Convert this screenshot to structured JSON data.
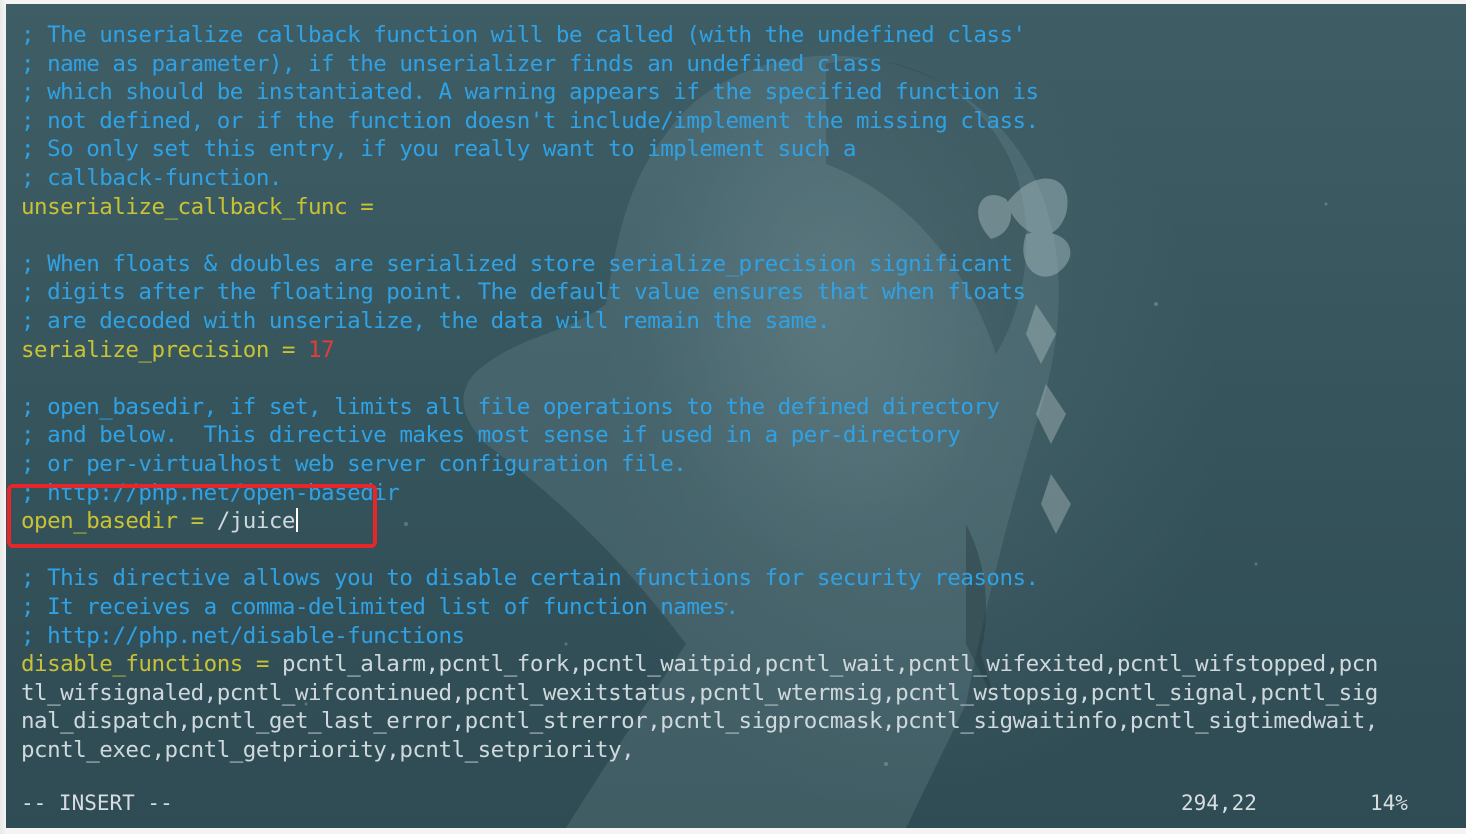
{
  "editor": {
    "lines": [
      {
        "segments": [
          {
            "t": "; The unserialize callback function will be called (with the undefined class'",
            "c": "c-cmt"
          }
        ]
      },
      {
        "segments": [
          {
            "t": "; name as parameter), if the unserializer finds an undefined class",
            "c": "c-cmt"
          }
        ]
      },
      {
        "segments": [
          {
            "t": "; which should be instantiated. A warning appears if the specified function is",
            "c": "c-cmt"
          }
        ]
      },
      {
        "segments": [
          {
            "t": "; not defined, or if the function doesn't include/implement the missing class.",
            "c": "c-cmt"
          }
        ]
      },
      {
        "segments": [
          {
            "t": "; So only set this entry, if you really want to implement such a",
            "c": "c-cmt"
          }
        ]
      },
      {
        "segments": [
          {
            "t": "; callback-function.",
            "c": "c-cmt"
          }
        ]
      },
      {
        "segments": [
          {
            "t": "unserialize_callback_func =",
            "c": "c-key"
          }
        ]
      },
      {
        "segments": []
      },
      {
        "segments": [
          {
            "t": "; When floats & doubles are serialized store serialize_precision significant",
            "c": "c-cmt"
          }
        ]
      },
      {
        "segments": [
          {
            "t": "; digits after the floating point. The default value ensures that when floats",
            "c": "c-cmt"
          }
        ]
      },
      {
        "segments": [
          {
            "t": "; are decoded with unserialize, the data will remain the same.",
            "c": "c-cmt"
          }
        ]
      },
      {
        "segments": [
          {
            "t": "serialize_precision = ",
            "c": "c-key"
          },
          {
            "t": "17",
            "c": "c-num"
          }
        ]
      },
      {
        "segments": []
      },
      {
        "segments": [
          {
            "t": "; open_basedir, if set, limits all file operations to the defined directory",
            "c": "c-cmt"
          }
        ]
      },
      {
        "segments": [
          {
            "t": "; and below.  This directive makes most sense if used in a per-directory",
            "c": "c-cmt"
          }
        ]
      },
      {
        "segments": [
          {
            "t": "; or per-virtualhost web server configuration file.",
            "c": "c-cmt"
          }
        ]
      },
      {
        "segments": [
          {
            "t": "; http://php.net/open-basedir",
            "c": "c-cmt"
          }
        ]
      },
      {
        "segments": [
          {
            "t": "open_basedir = ",
            "c": "c-key"
          },
          {
            "t": "/juice",
            "c": "c-val"
          }
        ],
        "cursor": true
      },
      {
        "segments": []
      },
      {
        "segments": [
          {
            "t": "; This directive allows you to disable certain functions for security reasons.",
            "c": "c-cmt"
          }
        ]
      },
      {
        "segments": [
          {
            "t": "; It receives a comma-delimited list of function names.",
            "c": "c-cmt"
          }
        ]
      },
      {
        "segments": [
          {
            "t": "; http://php.net/disable-functions",
            "c": "c-cmt"
          }
        ]
      },
      {
        "segments": [
          {
            "t": "disable_functions = ",
            "c": "c-key"
          },
          {
            "t": "pcntl_alarm,pcntl_fork,pcntl_waitpid,pcntl_wait,pcntl_wifexited,pcntl_wifstopped,pcn",
            "c": "c-val"
          }
        ]
      },
      {
        "segments": [
          {
            "t": "tl_wifsignaled,pcntl_wifcontinued,pcntl_wexitstatus,pcntl_wtermsig,pcntl_wstopsig,pcntl_signal,pcntl_sig",
            "c": "c-val"
          }
        ]
      },
      {
        "segments": [
          {
            "t": "nal_dispatch,pcntl_get_last_error,pcntl_strerror,pcntl_sigprocmask,pcntl_sigwaitinfo,pcntl_sigtimedwait,",
            "c": "c-val"
          }
        ]
      },
      {
        "segments": [
          {
            "t": "pcntl_exec,pcntl_getpriority,pcntl_setpriority,",
            "c": "c-val"
          }
        ]
      }
    ]
  },
  "statusbar": {
    "mode": "-- INSERT --",
    "position": "294,22",
    "percent": "14%"
  },
  "colors": {
    "comment": "#2fa2e6",
    "key": "#c9c234",
    "value": "#cfd8dc",
    "number": "#e63b3b",
    "highlight_box": "#e5262a"
  }
}
